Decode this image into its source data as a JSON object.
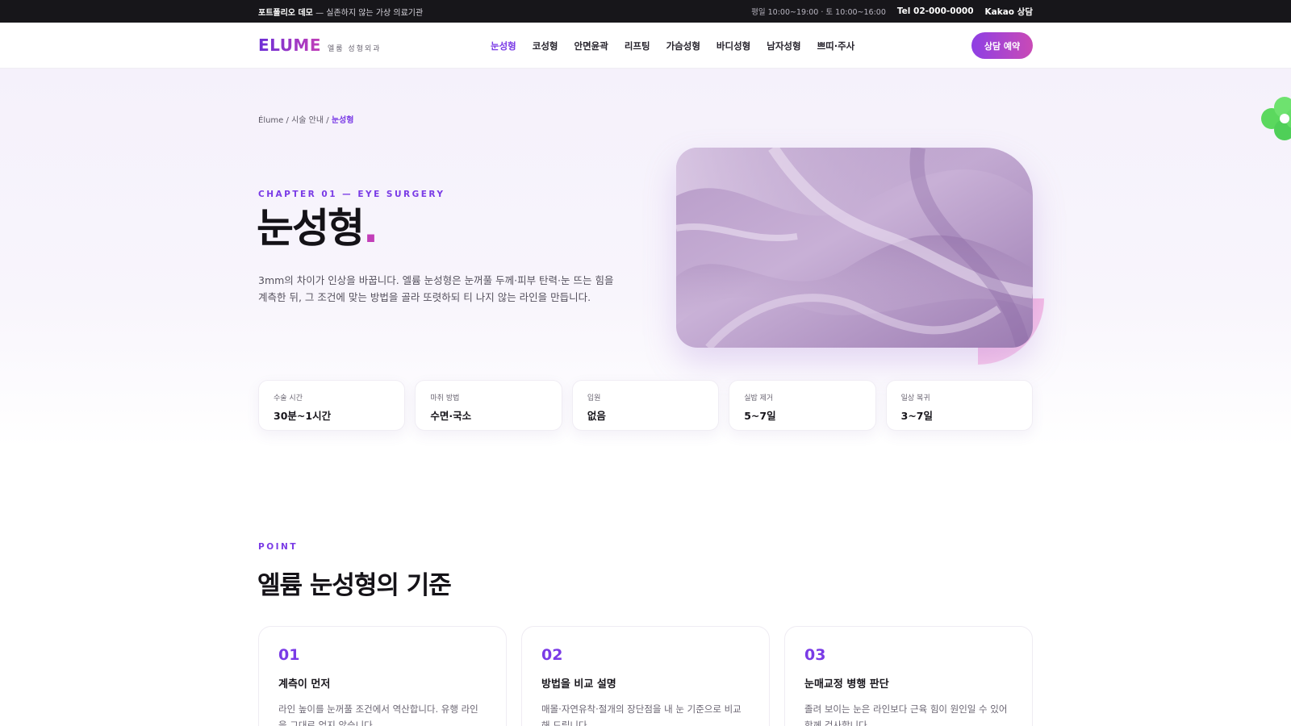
{
  "topbar": {
    "brand_label": "포트폴리오 데모",
    "brand_note": "— 실존하지 않는 가상 의료기관",
    "hours": "평일 10:00~19:00 · 토 10:00~16:00",
    "tel": "Tel 02-000-0000",
    "kakao": "Kakao 상담"
  },
  "nav": {
    "logo": "ELUME",
    "logo_sub": "엘룸 성형외과",
    "items": [
      "눈성형",
      "코성형",
      "안면윤곽",
      "리프팅",
      "가슴성형",
      "바디성형",
      "남자성형",
      "쁘띠·주사"
    ],
    "active_index": 0,
    "cta": "상담 예약"
  },
  "breadcrumb": {
    "home": "Élume",
    "section": "시술 안내",
    "current": "눈성형",
    "separator": "/"
  },
  "hero": {
    "eyebrow": "CHAPTER 01 — EYE SURGERY",
    "title": "눈성형",
    "title_dot": ".",
    "lead": "3mm의 차이가 인상을 바꿉니다. 엘륨 눈성형은 눈꺼풀 두께·피부 탄력·눈 뜨는 힘을 계측한 뒤, 그 조건에 맞는 방법을 골라 또렷하되 티 나지 않는 라인을 만듭니다."
  },
  "stats": [
    {
      "label": "수술 시간",
      "value": "30분~1시간"
    },
    {
      "label": "마취 방법",
      "value": "수면·국소"
    },
    {
      "label": "입원",
      "value": "없음"
    },
    {
      "label": "실밥 제거",
      "value": "5~7일"
    },
    {
      "label": "일상 복귀",
      "value": "3~7일"
    }
  ],
  "point": {
    "eyebrow": "POINT",
    "title": "엘륨 눈성형의 기준",
    "cards": [
      {
        "num": "01",
        "title": "계측이 먼저",
        "desc": "라인 높이를 눈꺼풀 조건에서 역산합니다. 유행 라인을 그대로 얹지 않습니다."
      },
      {
        "num": "02",
        "title": "방법을 비교 설명",
        "desc": "매몰·자연유착·절개의 장단점을 내 눈 기준으로 비교해 드립니다."
      },
      {
        "num": "03",
        "title": "눈매교정 병행 판단",
        "desc": "졸려 보이는 눈은 라인보다 근육 힘이 원인일 수 있어 함께 검사합니다."
      }
    ]
  },
  "colors": {
    "accent": "#7a3be6",
    "accent_pink": "#c23fb8",
    "topbar_bg": "#17161a",
    "blob": "#5bd85e"
  }
}
